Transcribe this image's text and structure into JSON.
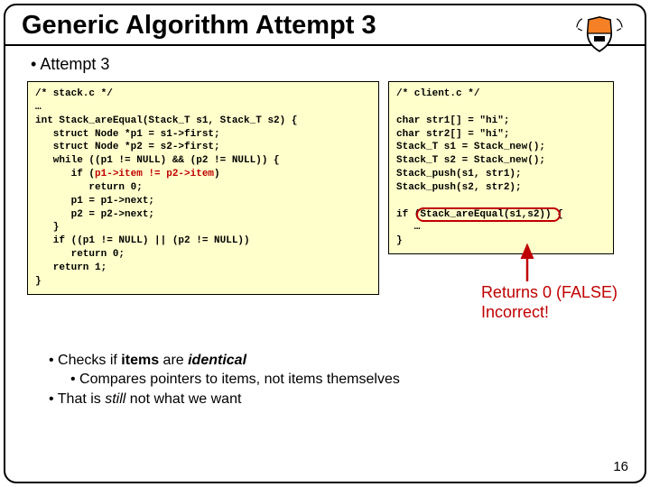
{
  "title": "Generic Algorithm Attempt 3",
  "bullet_top": "Attempt 3",
  "code_left": {
    "head": "/* stack.c */",
    "ellipsis": "…",
    "sig": "int Stack_areEqual(Stack_T s1, Stack_T s2) {",
    "l1": "   struct Node *p1 = s1->first;",
    "l2": "   struct Node *p2 = s2->first;",
    "l3": "   while ((p1 != NULL) && (p2 != NULL)) {",
    "l4a": "      if (",
    "l4b": "p1->item != p2->item",
    "l4c": ")",
    "l5": "         return 0;",
    "l6": "      p1 = p1->next;",
    "l7": "      p2 = p2->next;",
    "l8": "   }",
    "l9": "   if ((p1 != NULL) || (p2 != NULL))",
    "l10": "      return 0;",
    "l11": "   return 1;",
    "l12": "}"
  },
  "code_right": {
    "head": "/* client.c */",
    "l1": "char str1[] = \"hi\";",
    "l2": "char str2[] = \"hi\";",
    "l3": "Stack_T s1 = Stack_new();",
    "l4": "Stack_T s2 = Stack_new();",
    "l5": "Stack_push(s1, str1);",
    "l6": "Stack_push(s2, str2);",
    "l7a": "if (",
    "l7b": "Stack_areEqual(s1,s2)",
    "l7c": ") {",
    "l8": "   …",
    "l9": "}"
  },
  "callout": {
    "line1": "Returns 0 (FALSE)",
    "line2": "Incorrect!"
  },
  "bottom": {
    "b1a": "Checks if ",
    "b1b": "items",
    "b1c": " are ",
    "b1d": "identical",
    "b2": "Compares pointers to items, not items themselves",
    "b3a": "That is ",
    "b3b": "still",
    "b3c": " not what we want"
  },
  "page": "16"
}
